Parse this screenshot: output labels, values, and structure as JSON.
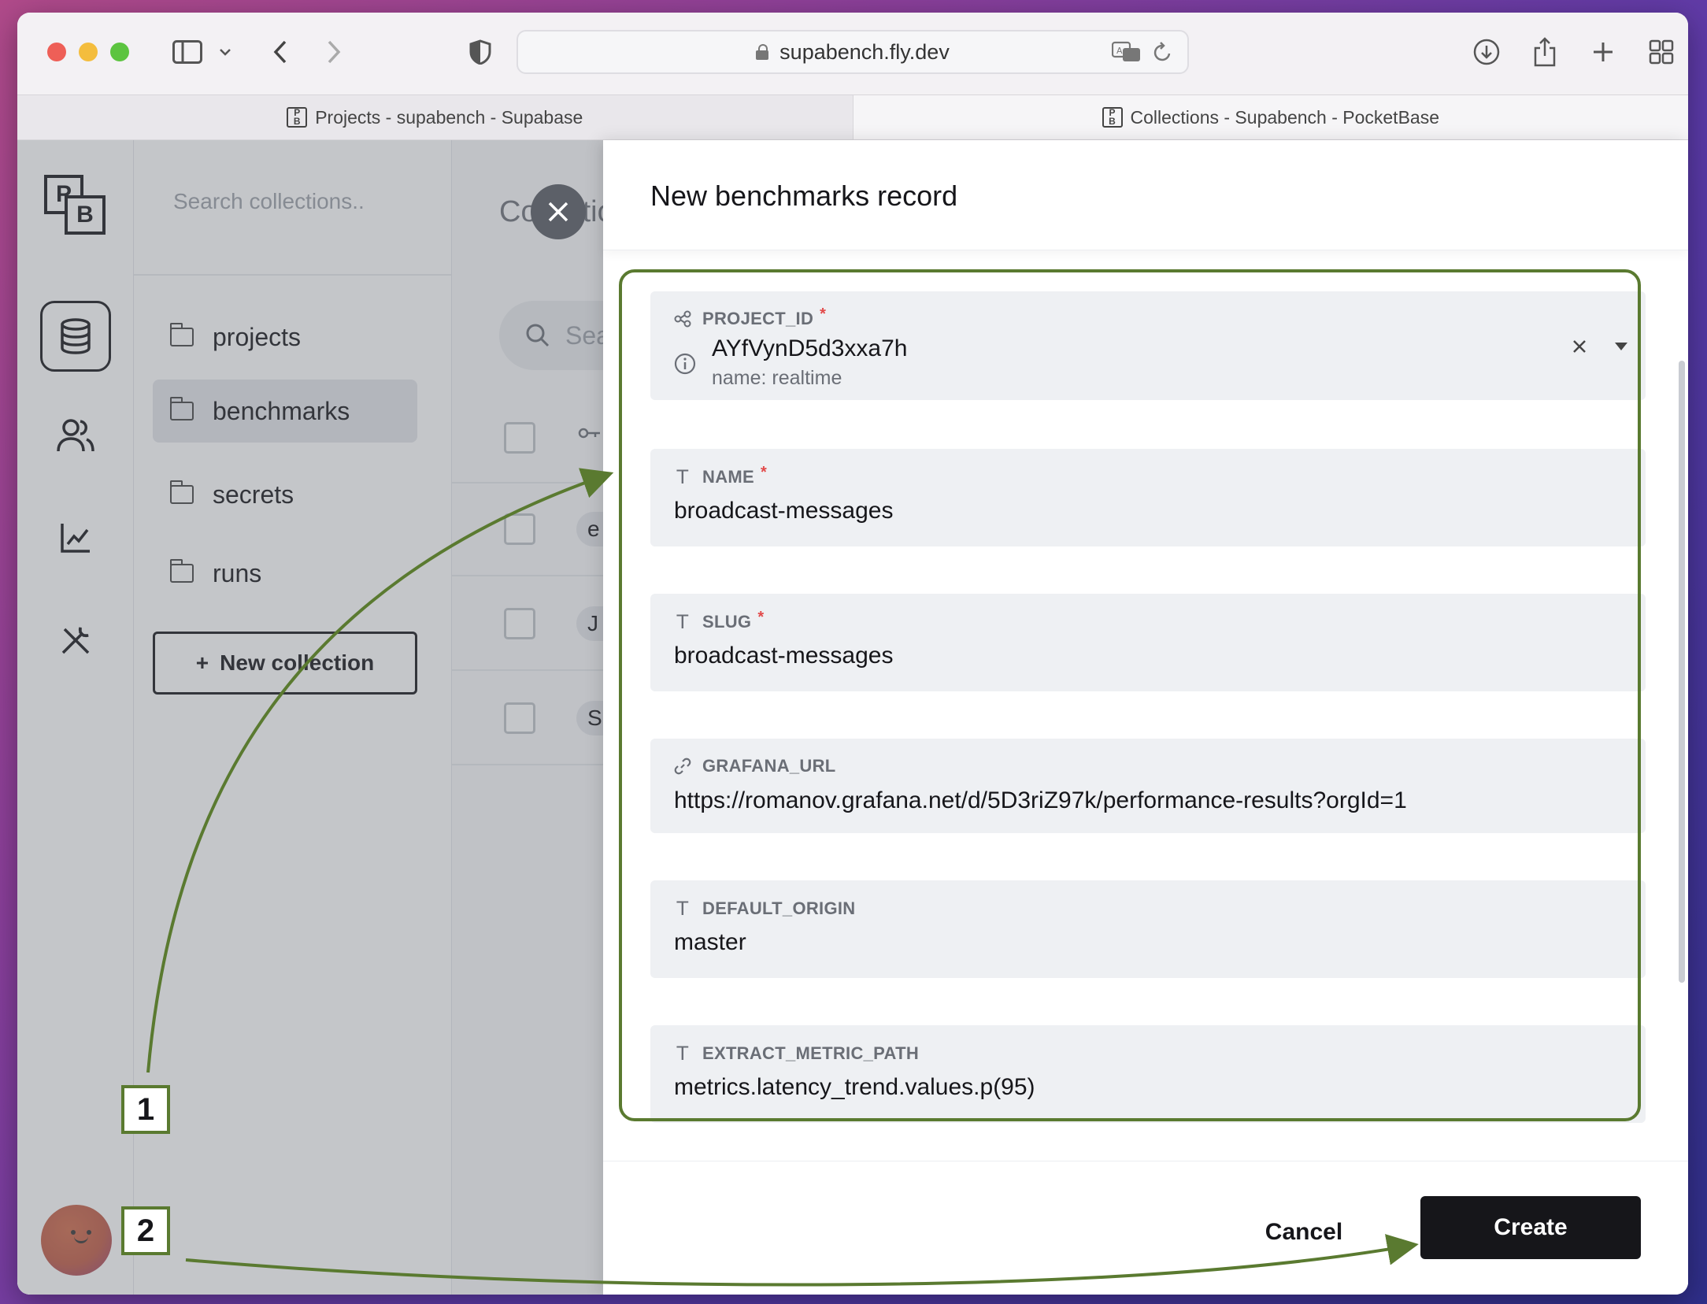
{
  "browser": {
    "url": "supabench.fly.dev",
    "tabs": [
      {
        "title": "Projects - supabench - Supabase",
        "favicon": "PB"
      },
      {
        "title": "Collections - Supabench - PocketBase",
        "favicon": "PB"
      }
    ]
  },
  "app": {
    "logo": {
      "top": "P",
      "bottom": "B"
    },
    "sidebar": {
      "search_placeholder": "Search collections..",
      "collections": [
        "projects",
        "benchmarks",
        "secrets",
        "runs"
      ],
      "active": "benchmarks",
      "new_collection_label": "New collection"
    },
    "main": {
      "title": "Collections",
      "search_placeholder": "Search",
      "row_pills": [
        "e",
        "J",
        "S"
      ]
    }
  },
  "panel": {
    "title": "New benchmarks record",
    "fields": [
      {
        "key": "project_id",
        "label": "PROJECT_ID",
        "required": true,
        "value": "AYfVynD5d3xxa7h",
        "sub": "name: realtime",
        "icon": "relation-icon"
      },
      {
        "key": "name",
        "label": "NAME",
        "required": true,
        "value": "broadcast-messages",
        "icon": "text-icon"
      },
      {
        "key": "slug",
        "label": "SLUG",
        "required": true,
        "value": "broadcast-messages",
        "icon": "text-icon"
      },
      {
        "key": "grafana_url",
        "label": "GRAFANA_URL",
        "required": false,
        "value": "https://romanov.grafana.net/d/5D3riZ97k/performance-results?orgId=1",
        "icon": "link-icon"
      },
      {
        "key": "default_origin",
        "label": "DEFAULT_ORIGIN",
        "required": false,
        "value": "master",
        "icon": "text-icon"
      },
      {
        "key": "extract_metric_path",
        "label": "EXTRACT_METRIC_PATH",
        "required": false,
        "value": "metrics.latency_trend.values.p(95)",
        "icon": "text-icon"
      }
    ],
    "required_mark": "*",
    "cancel_label": "Cancel",
    "create_label": "Create"
  },
  "annotations": {
    "step1": "1",
    "step2": "2",
    "color": "#5a7a30"
  }
}
